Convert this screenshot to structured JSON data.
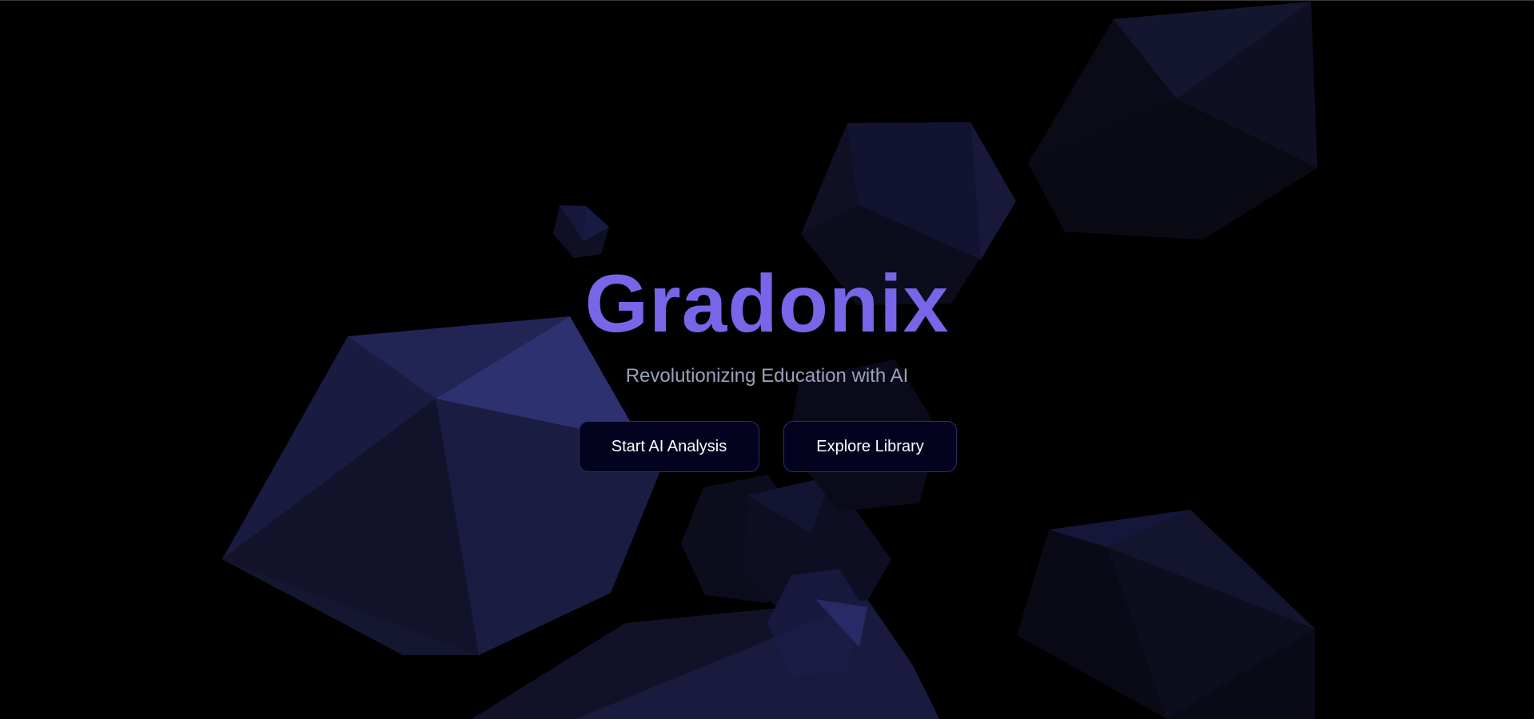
{
  "hero": {
    "title": "Gradonix",
    "tagline": "Revolutionizing Education with AI"
  },
  "actions": {
    "start_label": "Start AI Analysis",
    "explore_label": "Explore Library"
  },
  "colors": {
    "background": "#000000",
    "title": "#7766e8",
    "tagline": "#98a3b8",
    "button_background": "#030320",
    "button_border": "#2b2f66",
    "shape_face": "#1c1d44"
  }
}
